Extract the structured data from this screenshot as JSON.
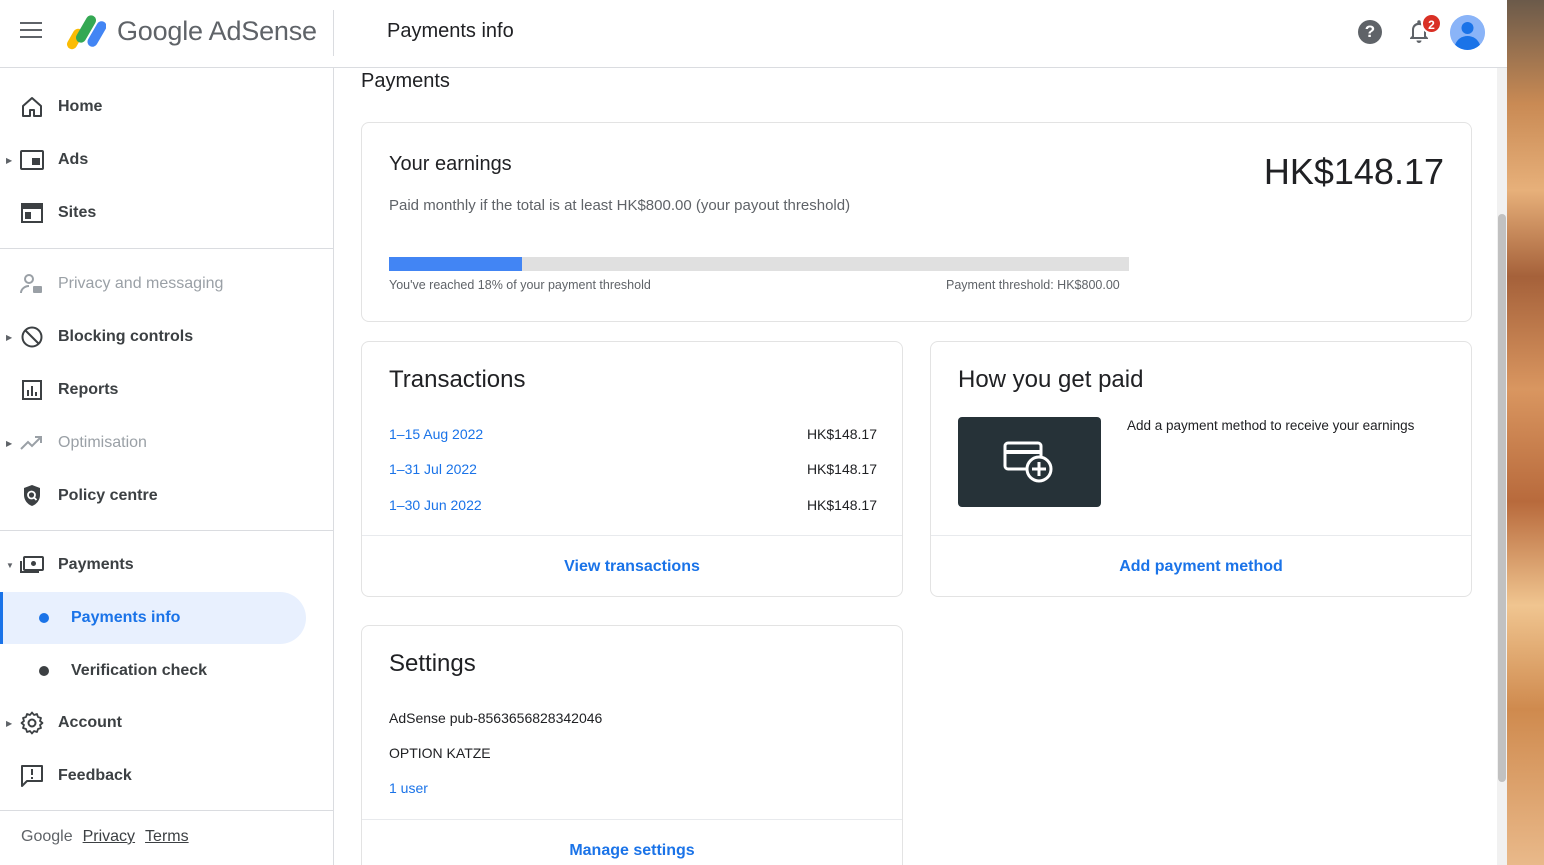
{
  "header": {
    "logo_text": "Google AdSense",
    "title": "Payments info",
    "notification_count": "2",
    "help_glyph": "?"
  },
  "sidebar": {
    "items": [
      {
        "label": "Home",
        "icon": "home-icon"
      },
      {
        "label": "Ads",
        "icon": "ads-icon"
      },
      {
        "label": "Sites",
        "icon": "sites-icon"
      },
      {
        "label": "Privacy and messaging",
        "icon": "privacy-icon"
      },
      {
        "label": "Blocking controls",
        "icon": "block-icon"
      },
      {
        "label": "Reports",
        "icon": "reports-icon"
      },
      {
        "label": "Optimisation",
        "icon": "optimisation-icon"
      },
      {
        "label": "Policy centre",
        "icon": "policy-icon"
      },
      {
        "label": "Payments",
        "icon": "payments-icon"
      },
      {
        "label": "Account",
        "icon": "account-gear-icon"
      },
      {
        "label": "Feedback",
        "icon": "feedback-icon"
      }
    ],
    "sub_items": [
      {
        "label": "Payments info"
      },
      {
        "label": "Verification check"
      }
    ],
    "footer": {
      "brand": "Google",
      "privacy": "Privacy",
      "terms": "Terms"
    }
  },
  "main": {
    "section_title": "Payments",
    "earnings": {
      "title": "Your earnings",
      "amount": "HK$148.17",
      "description": "Paid monthly if the total is at least HK$800.00 (your payout threshold)",
      "progress_fraction": 0.18,
      "progress_left": "You've reached 18% of your payment threshold",
      "progress_right": "Payment threshold: HK$800.00"
    },
    "transactions": {
      "title": "Transactions",
      "rows": [
        {
          "period": "1–15 Aug 2022",
          "amount": "HK$148.17"
        },
        {
          "period": "1–31 Jul 2022",
          "amount": "HK$148.17"
        },
        {
          "period": "1–30 Jun 2022",
          "amount": "HK$148.17"
        }
      ],
      "footer_link": "View transactions"
    },
    "how_paid": {
      "title": "How you get paid",
      "text": "Add a payment method to receive your earnings",
      "footer_link": "Add payment method"
    },
    "settings": {
      "title": "Settings",
      "publisher": "AdSense pub-8563656828342046",
      "name": "OPTION KATZE",
      "users_link": "1 user",
      "footer_link": "Manage settings"
    }
  },
  "colors": {
    "accent": "#1a73e8",
    "progress_fill": "#4285f4",
    "badge": "#d93025",
    "active_bg": "#e8f0fe"
  }
}
